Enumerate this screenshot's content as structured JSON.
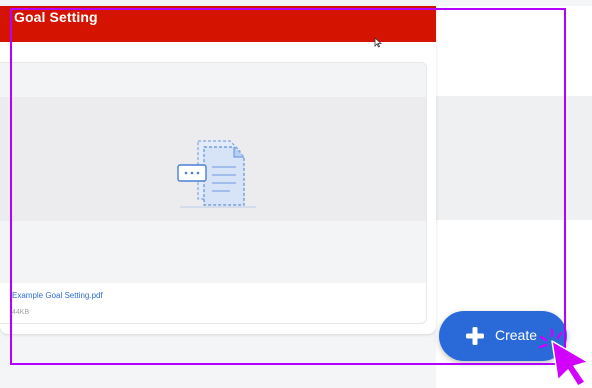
{
  "card": {
    "title": "Goal Setting",
    "header_color": "#d41300"
  },
  "file": {
    "name": "Example Goal Setting.pdf",
    "size": "44KB",
    "icon": "document-icon"
  },
  "create_button": {
    "label": "Create",
    "icon": "plus-icon",
    "color": "#2a6ad8"
  },
  "annotation": {
    "highlight_color": "#b300ff",
    "pointer": "pointer-arrow-icon"
  }
}
